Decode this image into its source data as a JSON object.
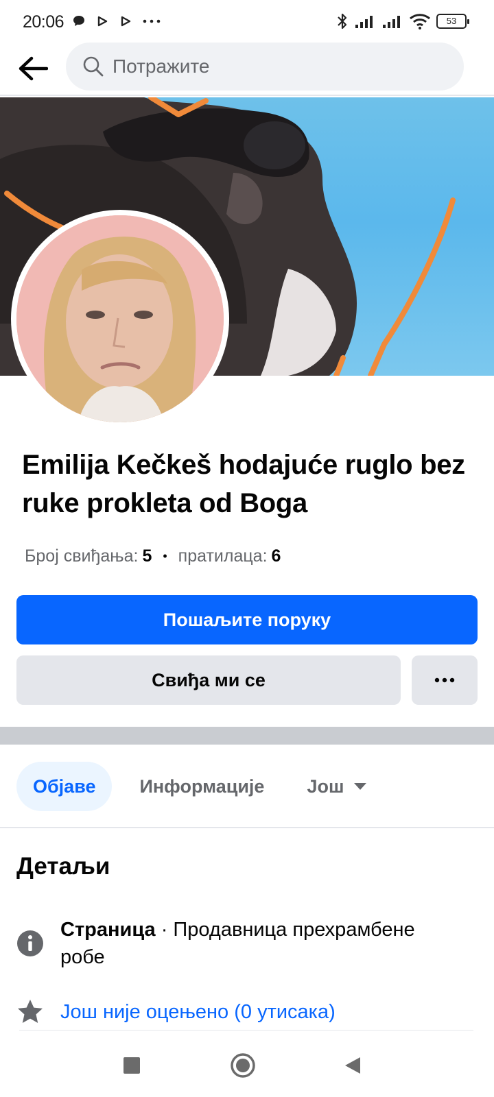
{
  "status_bar": {
    "time": "20:06",
    "battery": "53",
    "icons": [
      "chat-bubble-icon",
      "play-icon",
      "play-icon",
      "more-dots-icon",
      "bluetooth-icon",
      "signal-icon",
      "signal-icon",
      "wifi-icon",
      "battery-icon"
    ]
  },
  "search": {
    "placeholder": "Потражите"
  },
  "page": {
    "title": "Emilija Kečkeš hodajuće ruglo bez ruke prokleta od Boga",
    "likes_label": "Број свиђања:",
    "likes_count": "5",
    "followers_label": "пратилаца:",
    "followers_count": "6"
  },
  "buttons": {
    "message": "Пошаљите поруку",
    "like": "Свиђа ми се",
    "more": "more-dots-icon"
  },
  "tabs": [
    {
      "label": "Објаве",
      "active": true
    },
    {
      "label": "Информације",
      "active": false
    },
    {
      "label": "Још",
      "active": false
    }
  ],
  "details": {
    "title": "Детаљи",
    "category_type": "Страница",
    "category_name": "· Продавница прехрамбене робе",
    "rating": "Још није оцењено (0 утисака)"
  },
  "colors": {
    "primary": "#0866ff",
    "secondary_bg": "#e4e6eb",
    "muted_text": "#65676b",
    "tab_active_bg": "#ebf5ff",
    "cover_sky": "#5bb8ec",
    "cover_lines": "#f08a3a"
  }
}
